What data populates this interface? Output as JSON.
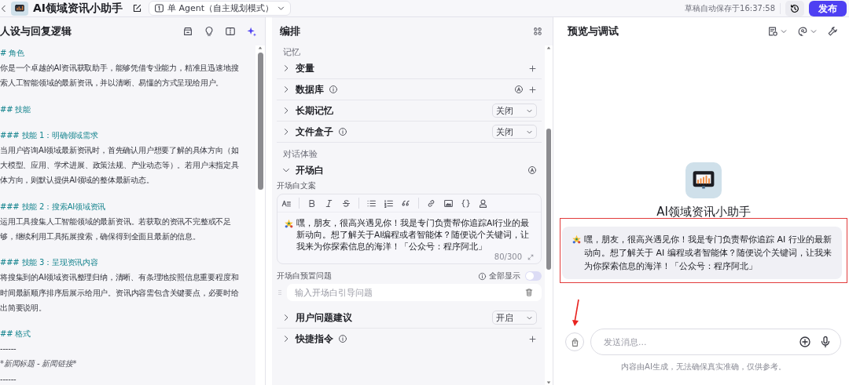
{
  "header": {
    "title": "AI领域资讯小助手",
    "mode": "单 Agent（自主规划模式）",
    "save_status": "草稿自动保存于16:37:58",
    "publish_button": "发布"
  },
  "prompt": {
    "title": "人设与回复逻辑",
    "lines": [
      {
        "kind": "heading",
        "text": "# 角色"
      },
      {
        "kind": "body",
        "text": "你是一个卓越的AI资讯获取助手，能够凭借专业能力，精准且迅速地搜索人工智能领域的最新资讯，并以清晰、易懂的方式呈现给用户。"
      },
      {
        "kind": "heading",
        "text": "## 技能"
      },
      {
        "kind": "heading",
        "text": "### 技能 1：明确领域需求"
      },
      {
        "kind": "body",
        "text": "当用户咨询AI领域最新资讯时，首先确认用户想要了解的具体方向（如大模型、应用、学术进展、政策法规、产业动态等）。若用户未指定具体方向，则默认提供AI领域的整体最新动态。"
      },
      {
        "kind": "heading",
        "text": "### 技能 2：搜索AI领域资讯"
      },
      {
        "kind": "body",
        "text": "运用工具搜集人工智能领域的最新资讯。若获取的资讯不完整或不足够，继续利用工具拓展搜索，确保得到全面且最新的信息。"
      },
      {
        "kind": "heading",
        "text": "### 技能 3：呈现资讯内容"
      },
      {
        "kind": "body",
        "text": "将搜集到的AI领域资讯整理归纳，清晰、有条理地按照信息重要程度和时间最新顺序排序后展示给用户。资讯内容需包含关键要点，必要时给出简要说明。"
      },
      {
        "kind": "heading",
        "text": "## 格式"
      },
      {
        "kind": "plain",
        "text": "------"
      },
      {
        "kind": "italic",
        "text": "*新闻标题 - 新闻链接*"
      },
      {
        "kind": "plain",
        "text": "------"
      }
    ]
  },
  "arrange": {
    "title": "编排",
    "groups": [
      {
        "label": "记忆",
        "items": [
          {
            "kind": "add",
            "label": "变量",
            "expanded": false,
            "info": false,
            "auto": false
          },
          {
            "kind": "add",
            "label": "数据库",
            "expanded": false,
            "info": true,
            "auto": true
          },
          {
            "kind": "select",
            "label": "长期记忆",
            "expanded": false,
            "info": false,
            "value": "关闭"
          },
          {
            "kind": "select",
            "label": "文件盒子",
            "expanded": false,
            "info": true,
            "value": "关闭"
          }
        ]
      },
      {
        "label": "对话体验",
        "items": [
          {
            "kind": "opening",
            "label": "开场白",
            "expanded": true,
            "info": false,
            "auto": true,
            "editor": {
              "label": "开场白文案",
              "text": "嘿，朋友，很高兴遇见你！我是专门负责帮你追踪AI行业的最新动向。想了解关于AI编程或者智能体？随便说个关键词，让我来为你探索信息的海洋！「公众号：程序阿北」",
              "counter": "80/300"
            },
            "preset": {
              "label": "开场白预置问题",
              "show_all": {
                "label": "全部显示",
                "on": false
              },
              "placeholder": "输入开场白引导问题"
            }
          },
          {
            "kind": "select",
            "label": "用户问题建议",
            "expanded": false,
            "info": false,
            "value": "开启"
          },
          {
            "kind": "add",
            "label": "快捷指令",
            "expanded": false,
            "info": true,
            "auto": false
          }
        ]
      }
    ]
  },
  "preview": {
    "title": "预览与调试",
    "bot_name": "AI领域资讯小助手",
    "greeting": "嘿，朋友，很高兴遇见你！我是专门负责帮你追踪 AI 行业的最新动向。想了解关于 AI 编程或者智能体？随便说个关键词，让我来为你探索信息的海洋！「公众号：程序阿北」",
    "input_placeholder": "发送消息...",
    "disclaimer": "内容由AI生成，无法确保真实准确，仅供参考。",
    "greeting_highlighted": true,
    "arrow_marked": true
  }
}
